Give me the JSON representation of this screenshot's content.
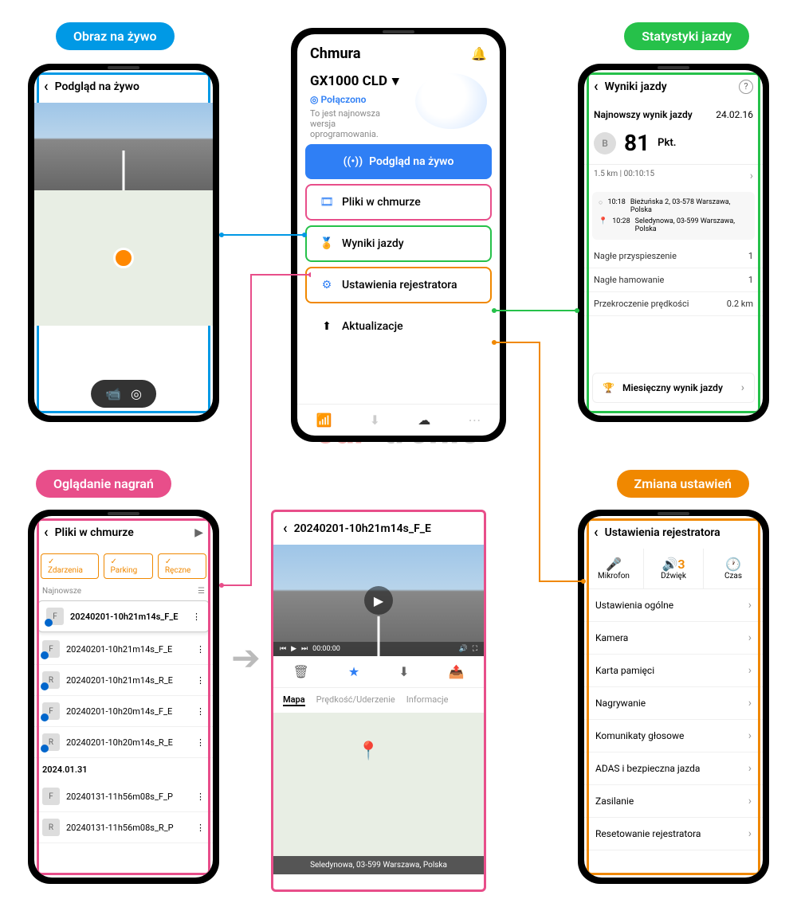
{
  "labels": {
    "live": "Obraz na żywo",
    "stats": "Statystyki jazdy",
    "recordings": "Oglądanie nagrań",
    "settings": "Zmiana ustawień"
  },
  "phone1": {
    "title": "Podgląd na żywo"
  },
  "phone2": {
    "title": "Chmura",
    "device": "GX1000 CLD",
    "connected": "Połączono",
    "fw_msg": "To jest najnowsza wersja oprogramowania.",
    "menu": {
      "live": "Podgląd na żywo",
      "cloud": "Pliki w chmurze",
      "results": "Wyniki jazdy",
      "settings": "Ustawienia rejestratora",
      "updates": "Aktualizacje"
    }
  },
  "phone3": {
    "title": "Wyniki jazdy",
    "latest_label": "Najnowszy wynik jazdy",
    "latest_date": "24.02.16",
    "score": "81",
    "score_unit": "Pkt.",
    "distance": "1.5 km",
    "duration": "00:10:15",
    "start_time": "10:18",
    "start_addr": "Bieżuńska 2, 03-578 Warszawa, Polska",
    "end_time": "10:28",
    "end_addr": "Seledynowa, 03-599 Warszawa, Polska",
    "accel_label": "Nagłe przyspieszenie",
    "accel_val": "1",
    "brake_label": "Nagłe hamowanie",
    "brake_val": "1",
    "speed_label": "Przekroczenie prędkości",
    "speed_val": "0.2 km",
    "monthly": "Miesięczny wynik jazdy"
  },
  "phone4": {
    "title": "Pliki w chmurze",
    "filters": [
      "Zdarzenia",
      "Parking",
      "Ręczne"
    ],
    "sort": "Najnowsze",
    "date_header": "2024.01.31",
    "files": [
      "20240201-10h21m14s_F_E",
      "20240201-10h21m14s_F_E",
      "20240201-10h21m14s_R_E",
      "20240201-10h20m14s_F_E",
      "20240201-10h20m14s_R_E",
      "20240131-11h56m08s_F_P",
      "20240131-11h56m08s_R_P"
    ]
  },
  "phone5": {
    "title": "20240201-10h21m14s_F_E",
    "time": "00:00:00",
    "tabs": [
      "Mapa",
      "Prędkość/Uderzenie",
      "Informacje"
    ],
    "address": "Seledynowa, 03-599 Warszawa, Polska"
  },
  "phone6": {
    "title": "Ustawienia rejestratora",
    "quick": {
      "mic": "Mikrofon",
      "sound": "Dźwięk",
      "sound_val": "3",
      "time": "Czas"
    },
    "rows": [
      "Ustawienia ogólne",
      "Kamera",
      "Karta pamięci",
      "Nagrywanie",
      "Komunikaty głosowe",
      "ADAS i bezpieczna jazda",
      "Zasilanie",
      "Resetowanie rejestratora"
    ]
  },
  "watermark": "car-tronic"
}
